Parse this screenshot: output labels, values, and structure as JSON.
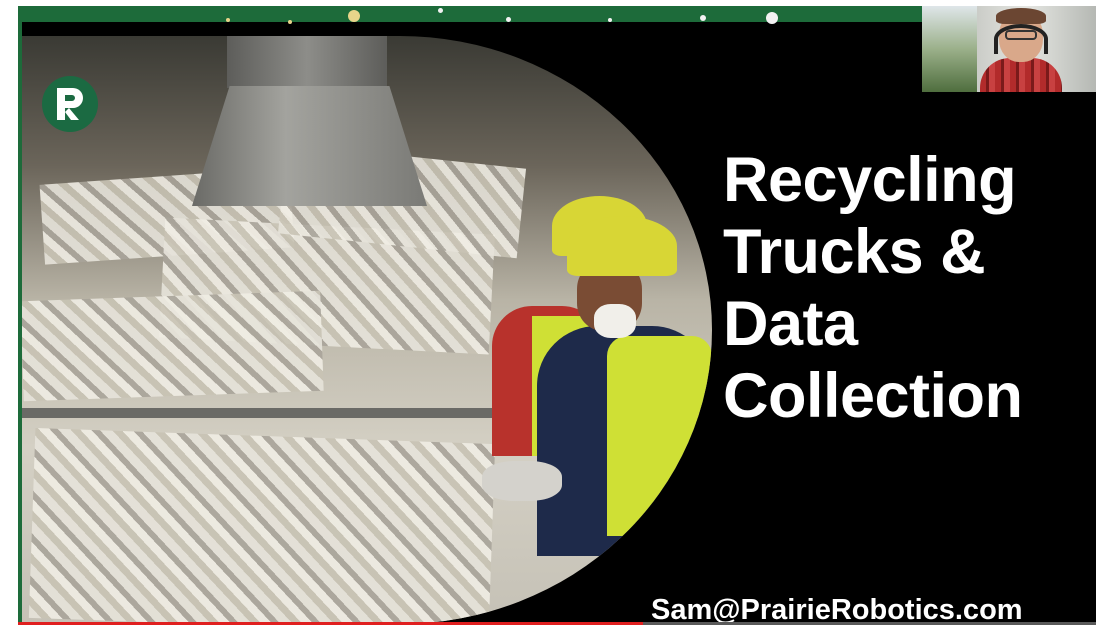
{
  "slide": {
    "title_lines": [
      "Recycling",
      "Trucks &",
      "Data",
      "Collection"
    ],
    "email": "Sam@PrairieRobotics.com",
    "logo_letter": "P",
    "photo_subject": "recycling-sorting-line-workers"
  },
  "video": {
    "progress": 0.58
  },
  "colors": {
    "brand_green": "#1d6b3a",
    "progress_red": "#e01f1f",
    "title_text": "#ffffff",
    "background": "#000000"
  },
  "icons": {
    "logo": "prairie-robotics-logo-icon"
  }
}
